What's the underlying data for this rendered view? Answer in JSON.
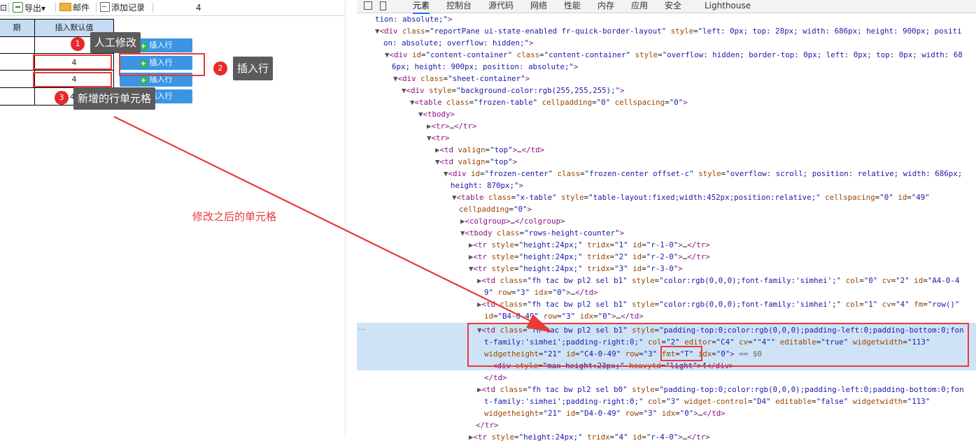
{
  "toolbar": {
    "export_label": "导出",
    "export_caret": "▾",
    "mail_label": "邮件",
    "add_record_label": "添加记录",
    "page_number": "4",
    "left_stub": "⊡"
  },
  "sheet": {
    "header_left": "期",
    "header_default": "插入默认值",
    "cell_values": [
      "",
      "4",
      "4",
      "4"
    ],
    "button_label": "插入行"
  },
  "annotations": {
    "badge1": "1",
    "tip1": "人工修改",
    "badge2": "2",
    "tip2": "插入行",
    "badge3": "3",
    "tip3": "新增的行单元格",
    "modified_note": "修改之后的单元格"
  },
  "devtools": {
    "tabs": [
      "元素",
      "控制台",
      "源代码",
      "网络",
      "性能",
      "内存",
      "应用",
      "安全",
      "Lighthouse"
    ],
    "active_tab": "元素",
    "selected_suffix": "== $0",
    "ellipsis": "..."
  },
  "colors": {
    "accent": "#1a73e8",
    "button_blue": "#3b95e4",
    "annotation_red": "#e83a3a",
    "header_fill": "#c6dcf2",
    "selection": "#cfe3f7"
  }
}
